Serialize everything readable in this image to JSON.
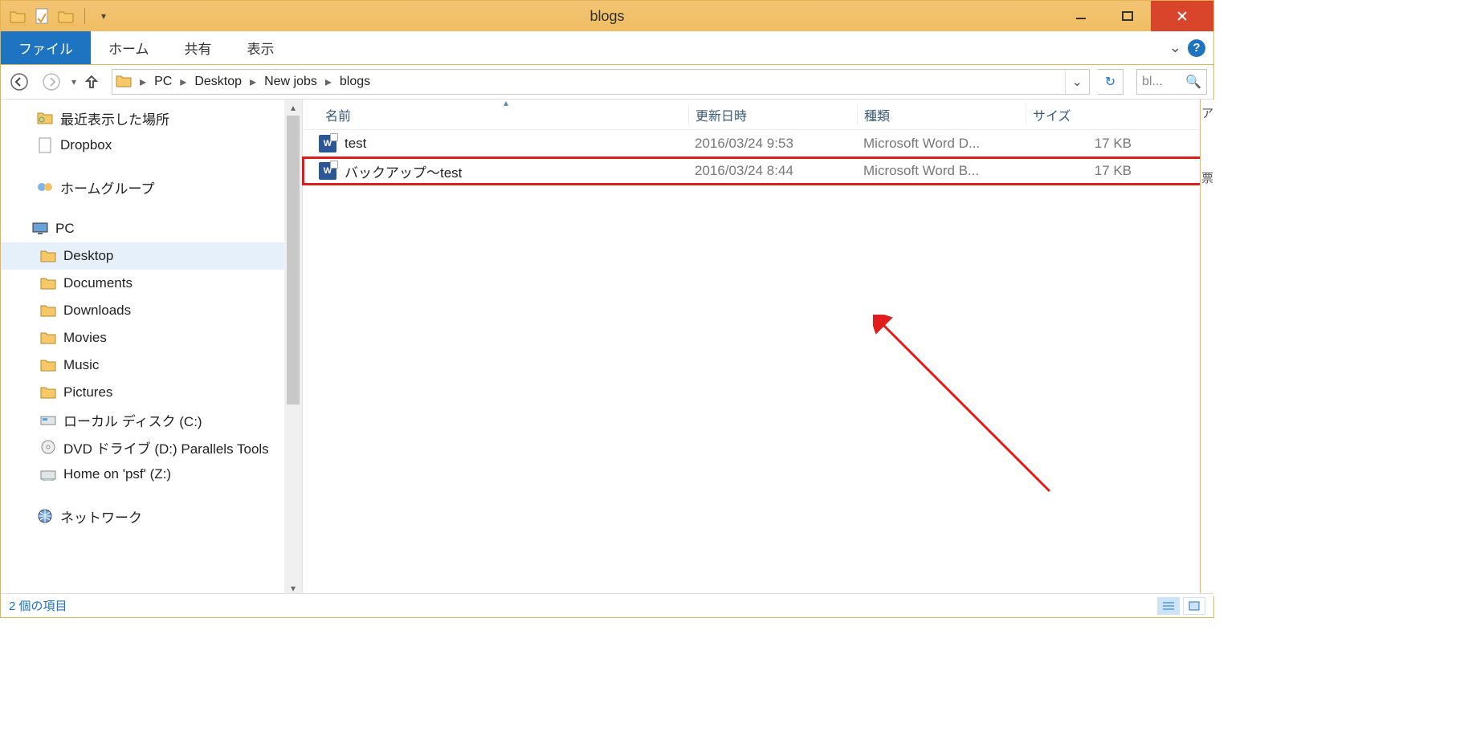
{
  "titlebar": {
    "title": "blogs"
  },
  "ribbon": {
    "file": "ファイル",
    "home": "ホーム",
    "share": "共有",
    "view": "表示"
  },
  "breadcrumbs": {
    "items": [
      "PC",
      "Desktop",
      "New jobs",
      "blogs"
    ]
  },
  "search": {
    "placeholder": "bl..."
  },
  "navpane": {
    "recent": "最近表示した場所",
    "dropbox": "Dropbox",
    "homegroup": "ホームグループ",
    "pc": "PC",
    "desktop": "Desktop",
    "documents": "Documents",
    "downloads": "Downloads",
    "movies": "Movies",
    "music": "Music",
    "pictures": "Pictures",
    "cdrive": "ローカル ディスク (C:)",
    "dvd": "DVD ドライブ (D:) Parallels Tools",
    "psf": "Home on 'psf' (Z:)",
    "network": "ネットワーク"
  },
  "columns": {
    "name": "名前",
    "date": "更新日時",
    "type": "種類",
    "size": "サイズ"
  },
  "files": [
    {
      "name": "test",
      "date": "2016/03/24 9:53",
      "type": "Microsoft Word D...",
      "size": "17 KB"
    },
    {
      "name": "バックアップ～test",
      "date": "2016/03/24 8:44",
      "type": "Microsoft Word B...",
      "size": "17 KB"
    }
  ],
  "statusbar": {
    "count": "2 個の項目"
  },
  "sidestrip": {
    "a": "ア",
    "b": "票"
  }
}
